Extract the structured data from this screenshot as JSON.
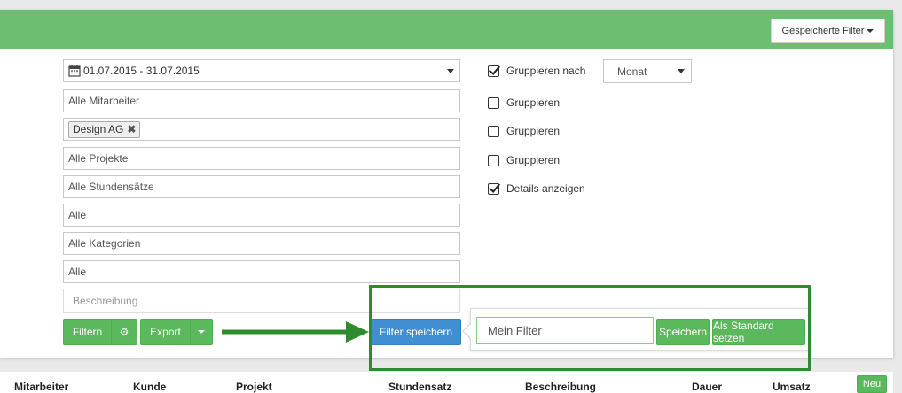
{
  "header": {
    "saved_filters_label": "Gespeicherte Filter",
    "color": "#6cbf71"
  },
  "filters": {
    "date_range": "01.07.2015 - 31.07.2015",
    "employee": "Alle Mitarbeiter",
    "customer_tag": "Design AG",
    "project": "Alle Projekte",
    "hourly_rate": "Alle Stundensätze",
    "field_6": "Alle",
    "category": "Alle Kategorien",
    "field_8": "Alle",
    "description_placeholder": "Beschreibung"
  },
  "options": {
    "group_by_label": "Gruppieren nach",
    "group_by_checked": true,
    "group_by_value": "Monat",
    "group_1_label": "Gruppieren",
    "group_2_label": "Gruppieren",
    "group_3_label": "Gruppieren",
    "details_label": "Details anzeigen",
    "details_checked": true
  },
  "actions": {
    "filter_label": "Filtern",
    "export_label": "Export",
    "save_filter_label": "Filter speichern",
    "filter_name_value": "Mein Filter",
    "save_label": "Speichern",
    "set_default_label": "Als Standard setzen"
  },
  "table": {
    "columns": [
      "Mitarbeiter",
      "Kunde",
      "Projekt",
      "Stundensatz",
      "Beschreibung",
      "Dauer",
      "Umsatz"
    ],
    "new_label": "Neu"
  },
  "colors": {
    "green": "#5cb85c",
    "blue": "#3f8fd2",
    "highlight": "#2e8b2e"
  },
  "icons": [
    "calendar-icon",
    "chevron-down-icon",
    "remove-tag-icon",
    "gear-icon",
    "arrow-icon",
    "checkbox-icon"
  ]
}
